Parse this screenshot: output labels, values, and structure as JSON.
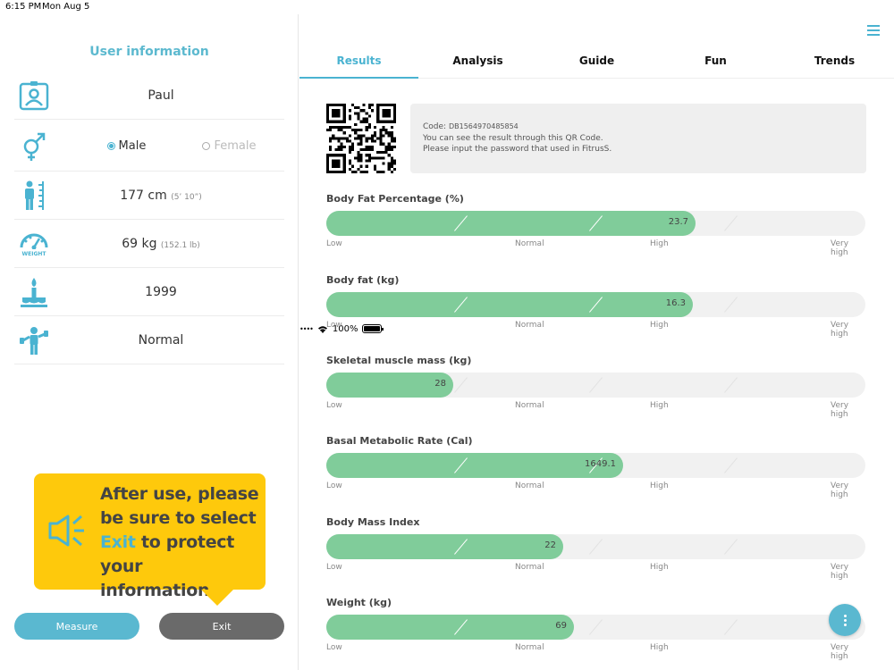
{
  "status_bar": {
    "time": "6:15 PM",
    "date": "Mon Aug 5",
    "battery": "100%"
  },
  "left": {
    "title": "User information",
    "name": "Paul",
    "gender": {
      "male": "Male",
      "female": "Female",
      "selected": "Male"
    },
    "height": {
      "value": "177 cm",
      "sub": "(5’ 10”)"
    },
    "weight": {
      "value": "69 kg",
      "sub": "(152.1 lb)",
      "icon_label": "WEIGHT"
    },
    "birth_year": "1999",
    "activity": "Normal",
    "notice": {
      "line1": "After use, please",
      "line2": "be sure to select",
      "exit_word": "Exit",
      "line3_rest": " to protect",
      "line4": "your information."
    },
    "buttons": {
      "measure": "Measure",
      "exit": "Exit"
    }
  },
  "tabs": [
    "Results",
    "Analysis",
    "Guide",
    "Fun",
    "Trends"
  ],
  "active_tab": "Results",
  "code_box": {
    "code_label": "Code:",
    "code_value": "DB1564970485854",
    "line2": "You can see the result through this QR Code.",
    "line3": "Please input the password that used in FitrusS."
  },
  "scale_labels": [
    "Low",
    "Normal",
    "High",
    "Very high"
  ],
  "metrics": [
    {
      "title": "Body Fat Percentage (%)",
      "value": "23.7",
      "fill_fraction": 0.685
    },
    {
      "title": "Body fat (kg)",
      "value": "16.3",
      "fill_fraction": 0.68
    },
    {
      "title": "Skeletal muscle mass (kg)",
      "value": "28",
      "fill_fraction": 0.235
    },
    {
      "title": "Basal Metabolic Rate (Cal)",
      "value": "1649.1",
      "fill_fraction": 0.55
    },
    {
      "title": "Body Mass Index",
      "value": "22",
      "fill_fraction": 0.44
    },
    {
      "title": "Weight (kg)",
      "value": "69",
      "fill_fraction": 0.46
    }
  ],
  "colors": {
    "accent": "#4ab3d1",
    "bar_fill": "#80cc9a",
    "notice_bg": "#fec90c",
    "exit_btn": "#6a6a6a"
  }
}
